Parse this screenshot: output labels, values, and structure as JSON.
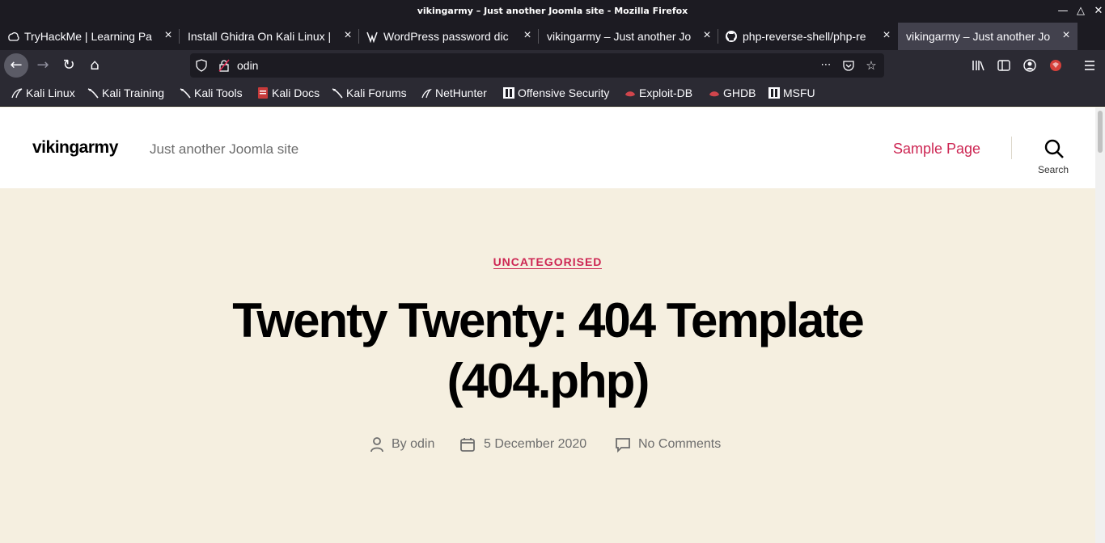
{
  "window": {
    "title": "vikingarmy – Just another Joomla site - Mozilla Firefox"
  },
  "tabs": [
    {
      "label": "TryHackMe | Learning Pa",
      "icon": "tryhackme-icon"
    },
    {
      "label": "Install Ghidra On Kali Linux |",
      "icon": ""
    },
    {
      "label": "WordPress password dic",
      "icon": "wordpress-icon"
    },
    {
      "label": "vikingarmy – Just another Jo",
      "icon": ""
    },
    {
      "label": "php-reverse-shell/php-re",
      "icon": "github-icon"
    },
    {
      "label": "vikingarmy – Just another Jo",
      "icon": "",
      "active": true
    }
  ],
  "toolbar": {
    "url": "odin"
  },
  "bookmarks": [
    {
      "label": "Kali Linux"
    },
    {
      "label": "Kali Training"
    },
    {
      "label": "Kali Tools"
    },
    {
      "label": "Kali Docs"
    },
    {
      "label": "Kali Forums"
    },
    {
      "label": "NetHunter"
    },
    {
      "label": "Offensive Security"
    },
    {
      "label": "Exploit-DB"
    },
    {
      "label": "GHDB"
    },
    {
      "label": "MSFU"
    }
  ],
  "site": {
    "title": "vikingarmy",
    "description": "Just another Joomla site",
    "nav_link": "Sample Page",
    "search_label": "Search"
  },
  "post": {
    "category": "UNCATEGORISED",
    "title": "Twenty Twenty: 404 Template (404.php)",
    "author": "By odin",
    "date": "5 December 2020",
    "comments": "No Comments"
  },
  "colors": {
    "accent": "#cd2653",
    "page_bg": "#f5efe0",
    "chrome_dark": "#1c1b22"
  }
}
